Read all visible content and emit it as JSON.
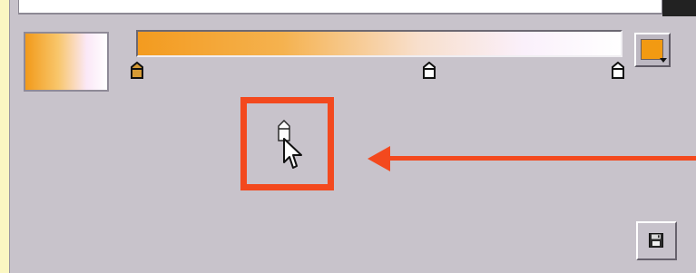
{
  "editor": {
    "gradient_preview": {
      "start_color": "#F29A1A",
      "end_color": "#FFFFFF"
    },
    "gradient_bar": {
      "colors": [
        "#F39B1F",
        "#F5B24F",
        "#F8DFCC",
        "#FAF0FB",
        "#FFFFFF"
      ]
    },
    "stops": [
      {
        "name": "orange-stop",
        "color": "#E8A23A"
      },
      {
        "name": "middle-stop",
        "color": "#FFFFFF"
      },
      {
        "name": "end-stop",
        "color": "#FFFFFF"
      }
    ],
    "color_picker": {
      "swatch_color": "#F29A12",
      "icon": "dropdown-arrow-icon"
    },
    "save_button": {
      "icon": "floppy-disk-icon"
    }
  },
  "annotation": {
    "color": "#F3491E",
    "target": "dragged-gradient-stop"
  }
}
